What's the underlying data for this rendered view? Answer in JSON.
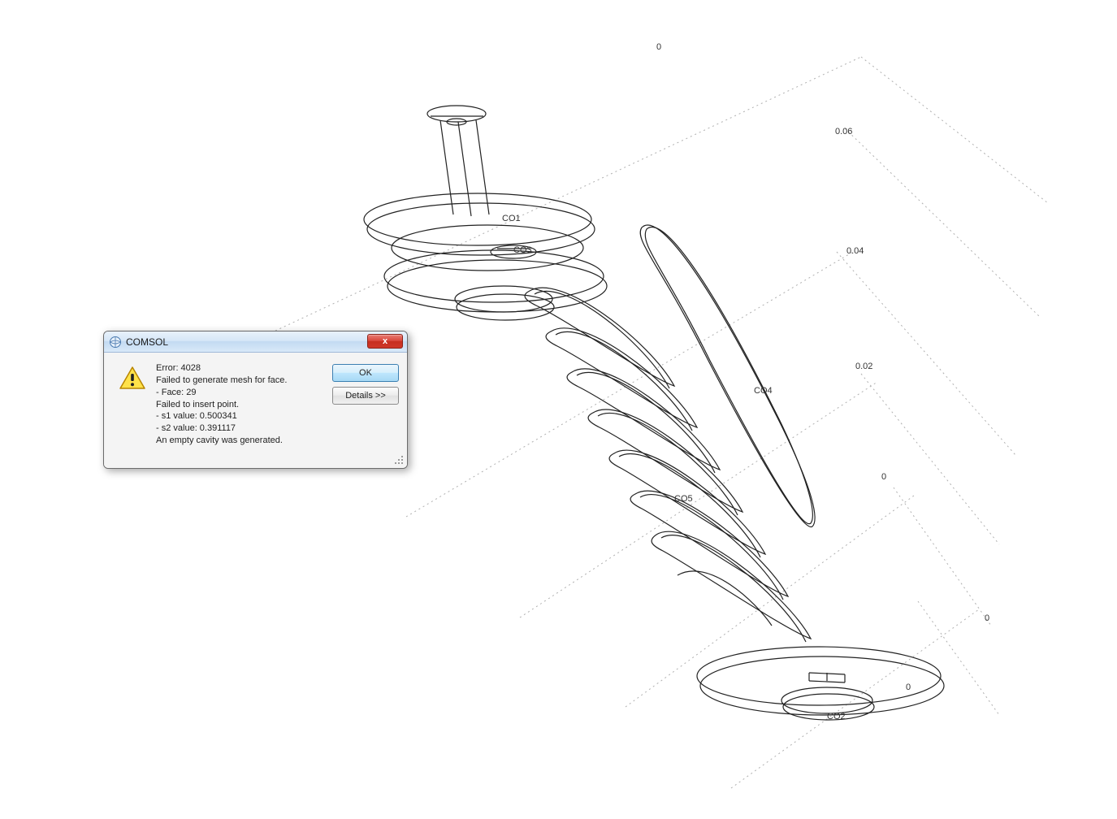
{
  "dialog": {
    "title": "COMSOL",
    "error_line": "Error: 4028",
    "msg1": "Failed to generate mesh for face.",
    "msg2": "- Face: 29",
    "msg3": "Failed to insert point.",
    "msg4": "- s1 value: 0.500341",
    "msg5": "- s2 value: 0.391117",
    "msg6": "An empty cavity was generated.",
    "ok_label": "OK",
    "details_label": "Details >>",
    "close_label": "x"
  },
  "geometry": {
    "labels": {
      "co1": "CO1",
      "co2": "CO2",
      "co3": "CO3",
      "co4": "CO4",
      "co5": "CO5"
    },
    "axis_ticks": {
      "tick_top": "0",
      "tick_006": "0.06",
      "tick_004": "0.04",
      "tick_002": "0.02",
      "tick_right_a": "0",
      "tick_right_b": "0",
      "tick_bottom": "0"
    }
  }
}
